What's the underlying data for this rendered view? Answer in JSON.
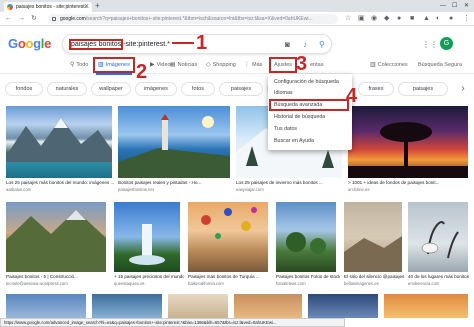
{
  "browser": {
    "tab_title": "paisajes bonitos - site:pinterest...",
    "url_host": "google.com",
    "url_rest": "/search?q=paisajes+bonitos+-site:pinterest.*&tbm=isch&source=lnt&tbs=isz:l&sa=X&ved=0ahUKEwi...",
    "icons": {
      "back": "arrow-left-icon",
      "forward": "arrow-right-icon",
      "reload": "reload-icon",
      "star": "star-icon",
      "menu": "more-vert-icon"
    }
  },
  "header": {
    "logo_letters": [
      "G",
      "o",
      "o",
      "g",
      "l",
      "e"
    ],
    "query_highlighted": "paisajes bonitos",
    "query_rest": " -site:pinterest.*",
    "avatar_letter": "G"
  },
  "tabs": {
    "todo": "Todo",
    "imagenes": "Imágenes",
    "videos": "Videos",
    "noticias": "Noticias",
    "shopping": "Shopping",
    "mas": "Más",
    "ajustes": "Ajustes",
    "herramientas": "entas",
    "colecciones": "Colecciones",
    "segura": "Búsqueda Segura"
  },
  "chips": [
    "fondos",
    "naturales",
    "wallpaper",
    "imágenes",
    "fotos",
    "paisajes",
    "pantalla",
    "",
    "frases",
    "paisajes"
  ],
  "menu": {
    "items": [
      "Configuración de búsqueda",
      "Idiomas",
      "Búsqueda avanzada",
      "Historial de búsqueda",
      "Tus datos",
      "Buscar en Ayuda"
    ]
  },
  "annotations": [
    "1",
    "2",
    "3",
    "4"
  ],
  "results_row1": [
    {
      "caption": "Los 25 paisajes más bonitos del mundo: imágenes ...",
      "source": "aarbalus.com"
    },
    {
      "caption": "Bonitos paisajes reales y pintados - Ho...",
      "source": "paisajesbonitos.net"
    },
    {
      "caption": "Los 25 paisajes de invierno más bonitos ...",
      "source": "easyviajar.com"
    },
    {
      "caption": "",
      "source": ""
    },
    {
      "caption": "> 1001 + ideas de fondos de paisajes bonit...",
      "source": "archzine.es"
    }
  ],
  "results_row2": [
    {
      "caption": "Paisajes bonitos - 5 | Construcció...",
      "source": "tecnolo@aesewa.wordpress.com"
    },
    {
      "caption": "+ 15 paisajes preciosos del mundo ...",
      "source": "queestaquiex.es"
    },
    {
      "caption": "Paisajes más bonitos de Turquía ...",
      "source": "baikecalifornia.com"
    },
    {
      "caption": "Paisajes bonitos Fotos de stock ...",
      "source": "fotoaleteas.com"
    },
    {
      "caption": "El sitio del silencio @paisajes ...",
      "source": "bellasimagenes.es"
    },
    {
      "caption": "40 de los lugares más bonitos ...",
      "source": "emilenencia.com"
    }
  ],
  "status_url": "https://www.google.com/advanced_image_search?hl=es&q=paisajes+bonitos+-site:pinterest.*&biw=1366&bih=657&tbs=isz:l&ved=0ahUKEwi..."
}
